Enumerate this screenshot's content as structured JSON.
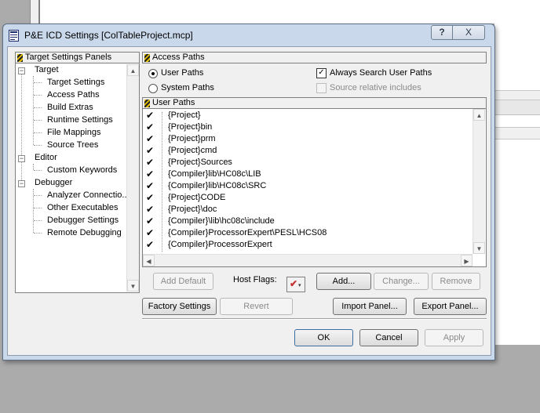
{
  "dialog": {
    "title": "P&E ICD Settings [ColTableProject.mcp]",
    "help_button": "?",
    "close_button": "X"
  },
  "left_panel": {
    "header": "Target Settings Panels",
    "tree": [
      {
        "label": "Target",
        "children": [
          "Target Settings",
          "Access Paths",
          "Build Extras",
          "Runtime Settings",
          "File Mappings",
          "Source Trees"
        ]
      },
      {
        "label": "Editor",
        "children": [
          "Custom Keywords"
        ]
      },
      {
        "label": "Debugger",
        "children": [
          "Analyzer Connectio...",
          "Other Executables",
          "Debugger Settings",
          "Remote Debugging"
        ]
      }
    ]
  },
  "access_paths": {
    "header": "Access Paths",
    "radio_user_paths": "User Paths",
    "radio_system_paths": "System Paths",
    "selected": "User Paths",
    "always_search_label": "Always Search User Paths",
    "always_search_checked": true,
    "source_relative_label": "Source relative includes",
    "source_relative_enabled": false,
    "list_header": "User Paths",
    "paths": [
      "{Project}",
      "{Project}bin",
      "{Project}prm",
      "{Project}cmd",
      "{Project}Sources",
      "{Compiler}lib\\HC08c\\LIB",
      "{Compiler}lib\\HC08c\\SRC",
      "{Project}CODE",
      "{Project}\\doc",
      "{Compiler}\\lib\\hc08c\\include",
      "{Compiler}ProcessorExpert\\PESL\\HCS08",
      "{Compiler}ProcessorExpert"
    ],
    "buttons": {
      "add_default": "Add Default",
      "host_flags_label": "Host Flags:",
      "add": "Add...",
      "change": "Change...",
      "remove": "Remove"
    }
  },
  "bottom": {
    "factory_settings": "Factory Settings",
    "revert": "Revert",
    "import_panel": "Import Panel...",
    "export_panel": "Export Panel...",
    "ok": "OK",
    "cancel": "Cancel",
    "apply": "Apply"
  }
}
